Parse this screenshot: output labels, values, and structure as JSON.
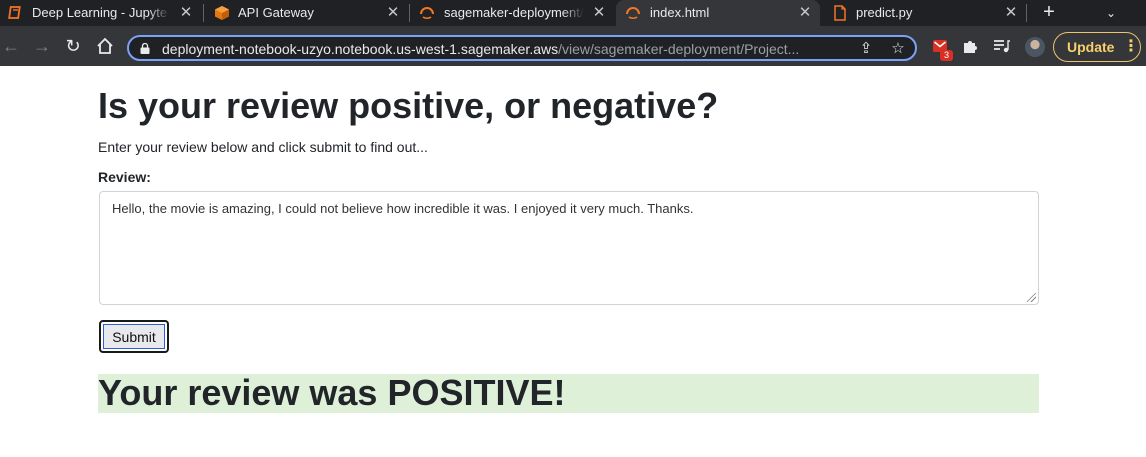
{
  "browser": {
    "tabs": [
      {
        "title": "Deep Learning - Jupyter",
        "icon": "jupyter-book-icon",
        "active": false
      },
      {
        "title": "API Gateway",
        "icon": "aws-cube-icon",
        "active": false
      },
      {
        "title": "sagemaker-deployment/",
        "icon": "jupyter-spinner-icon",
        "active": false
      },
      {
        "title": "index.html",
        "icon": "jupyter-spinner-icon",
        "active": true
      },
      {
        "title": "predict.py",
        "icon": "file-icon",
        "active": false
      }
    ],
    "url_host": "deployment-notebook-uzyo.notebook.us-west-1.sagemaker.aws",
    "url_path": "/view/sagemaker-deployment/Project...",
    "extension_badge": "3",
    "update_label": "Update"
  },
  "page": {
    "title": "Is your review positive, or negative?",
    "lead": "Enter your review below and click submit to find out...",
    "review_label": "Review:",
    "review_text": "Hello, the movie is amazing, I could not believe how incredible it was. I enjoyed it very much. Thanks.",
    "submit_label": "Submit",
    "result": "Your review was POSITIVE!"
  },
  "colors": {
    "result_background": "#dff0d8",
    "tab_strip": "#202124",
    "toolbar": "#35363a",
    "omnibox_focus": "#7aa2f7",
    "update_accent": "#f8d06b"
  }
}
